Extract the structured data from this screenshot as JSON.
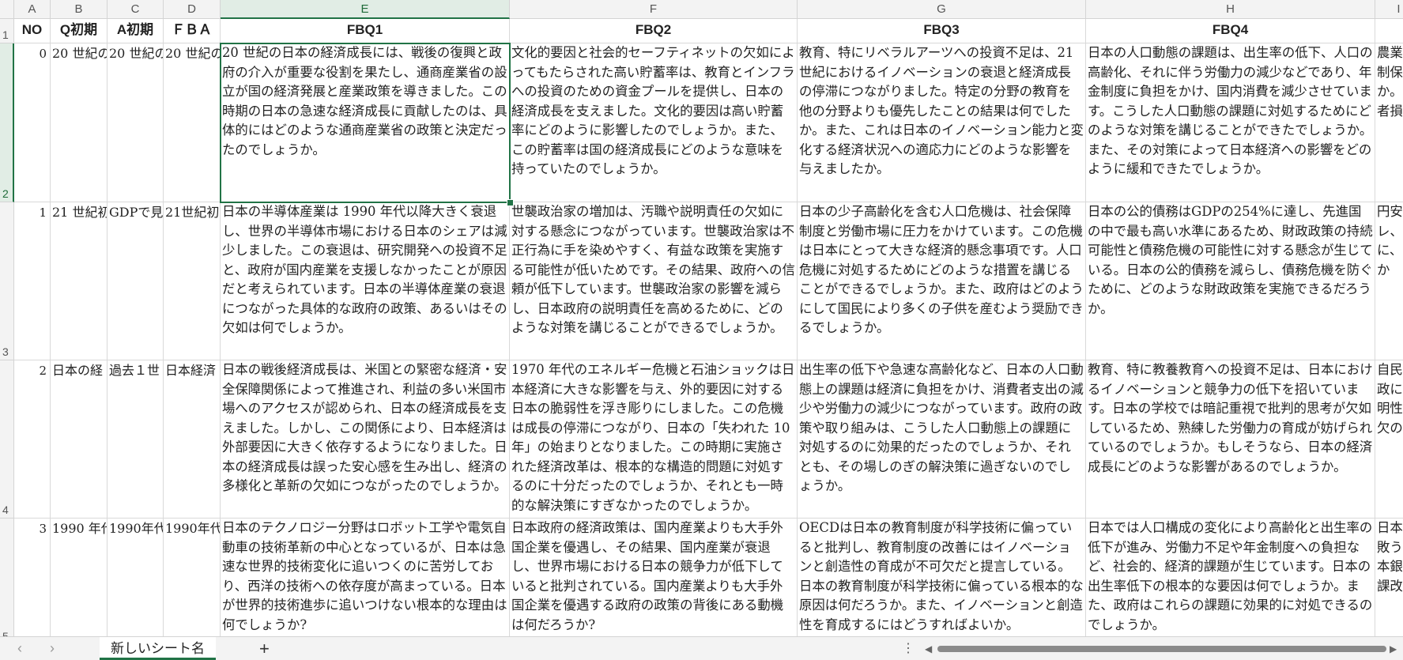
{
  "sheet": {
    "columns": [
      {
        "letter": "A",
        "header": "NO"
      },
      {
        "letter": "B",
        "header": "Q初期"
      },
      {
        "letter": "C",
        "header": "A初期"
      },
      {
        "letter": "D",
        "header": "ＦＢＡ"
      },
      {
        "letter": "E",
        "header": "FBQ1"
      },
      {
        "letter": "F",
        "header": "FBQ2"
      },
      {
        "letter": "G",
        "header": "FBQ3"
      },
      {
        "letter": "H",
        "header": "FBQ4"
      },
      {
        "letter": "I",
        "header": ""
      }
    ],
    "row_numbers": [
      "1",
      "2",
      "3",
      "4",
      "5"
    ],
    "rows": [
      {
        "no": "0",
        "b": "20 世紀の",
        "c": "20 世紀の",
        "d": "20 世紀の",
        "e": "20 世紀の日本の経済成長には、戦後の復興と政府の介入が重要な役割を果たし、通商産業省の設立が国の経済発展と産業政策を導きました。この時期の日本の急速な経済成長に貢献したのは、具体的にはどのような通商産業省の政策と決定だったのでしょうか。",
        "f": "文化的要因と社会的セーフティネットの欠如によってもたらされた高い貯蓄率は、教育とインフラへの投資のための資金プールを提供し、日本の経済成長を支えました。文化的要因は高い貯蓄率にどのように影響したのでしょうか。また、この貯蓄率は国の経済成長にどのような意味を持っていたのでしょうか。",
        "g": "教育、特にリベラルアーツへの投資不足は、21 世紀におけるイノベーションの衰退と経済成長の停滞につながりました。特定の分野の教育を他の分野よりも優先したことの結果は何でしたか。また、これは日本のイノベーション能力と変化する経済状況への適応力にどのような影響を与えましたか。",
        "h": "日本の人口動態の課題は、出生率の低下、人口の高齢化、それに伴う労働力の減少などであり、年金制度に負担をかけ、国内消費を減少させています。こうした人口動態の課題に対処するためにどのような対策を講じることができたでしょうか。また、その対策によって日本経済への影響をどのように緩和できたでしょうか。",
        "i": "農業抑制保護か。係者損害"
      },
      {
        "no": "1",
        "b": "21 世紀初",
        "c": "GDPで見",
        "d": "21世紀初",
        "e": "日本の半導体産業は 1990 年代以降大きく衰退し、世界の半導体市場における日本のシェアは減少しました。この衰退は、研究開発への投資不足と、政府が国内産業を支援しなかったことが原因だと考えられています。日本の半導体産業の衰退につながった具体的な政府の政策、あるいはその欠如は何でしょうか。",
        "f": "世襲政治家の増加は、汚職や説明責任の欠如に対する懸念につながっています。世襲政治家は不正行為に手を染めやすく、有益な政策を実施する可能性が低いためです。その結果、政府への信頼が低下しています。世襲政治家の影響を減らし、日本政府の説明責任を高めるために、どのような対策を講じることができるでしょうか。",
        "g": "日本の少子高齢化を含む人口危機は、社会保障制度と労働市場に圧力をかけています。この危機は日本にとって大きな経済的懸念事項です。人口危機に対処するためにどのような措置を講じることができるでしょうか。また、政府はどのようにして国民により多くの子供を産むよう奨励できるでしょうか。",
        "h": "日本の公的債務はGDPの254%に達し、先進国の中で最も高い水準にあるため、財政政策の持続可能性と債務危機の可能性に対する懸念が生じている。日本の公的債務を減らし、債務危機を防ぐために、どのような財政政策を実施できるだろうか。",
        "i": "円安レ、に、うか"
      },
      {
        "no": "2",
        "b": "日本の経",
        "c": "過去１世",
        "d": "日本経済",
        "e": "日本の戦後経済成長は、米国との緊密な経済・安全保障関係によって推進され、利益の多い米国市場へのアクセスが認められ、日本の経済成長を支えました。しかし、この関係により、日本経済は外部要因に大きく依存するようになりました。日本の経済成長は誤った安心感を生み出し、経済の多様化と革新の欠如につながったのでしょうか。",
        "f": "1970 年代のエネルギー危機と石油ショックは日本経済に大きな影響を与え、外的要因に対する日本の脆弱性を浮き彫りにしました。この危機は成長の停滞につながり、日本の「失われた 10 年」の始まりとなりました。この時期に実施された経済改革は、根本的な構造的問題に対処するのに十分だったのでしょうか、それとも一時的な解決策にすぎなかったのでしょうか。",
        "g": "出生率の低下や急速な高齢化など、日本の人口動態上の課題は経済に負担をかけ、消費者支出の減少や労働力の減少につながっています。政府の政策や取り組みは、こうした人口動態上の課題に対処するのに効果的だったのでしょうか、それとも、その場しのぎの解決策に過ぎないのでしょうか。",
        "h": "教育、特に教養教育への投資不足は、日本におけるイノベーションと競争力の低下を招いています。日本の学校では暗記重視で批判的思考が欠如しているため、熟練した労働力の育成が妨げられているのでしょうか。もしそうなら、日本の経済成長にどのような影響があるのでしょうか。",
        "i": "自民の政に対明性の欠のよ"
      },
      {
        "no": "3",
        "b": "1990 年代",
        "c": "1990年代",
        "d": "1990年代",
        "e": "日本のテクノロジー分野はロボット工学や電気自動車の技術革新の中心となっているが、日本は急速な世界的技術変化に追いつくのに苦労しており、西洋の技術への依存度が高まっている。日本が世界的技術進歩に追いつけない根本的な理由は何でしょうか?",
        "f": "日本政府の経済政策は、国内産業よりも大手外国企業を優遇し、その結果、国内産業が衰退し、世界市場における日本の競争力が低下していると批判されている。国内産業よりも大手外国企業を優遇する政府の政策の背後にある動機は何だろうか?",
        "g": "OECDは日本の教育制度が科学技術に偏っていると批判し、教育制度の改善にはイノベーションと創造性の育成が不可欠だと提言している。日本の教育制度が科学技術に偏っている根本的な原因は何だろうか。また、イノベーションと創造性を育成するにはどうすればよいか。",
        "h": "日本では人口構成の変化により高齢化と出生率の低下が進み、労働力不足や年金制度への負担など、社会的、経済的課題が生じています。日本の出生率低下の根本的な要因は何でしょうか。また、政府はこれらの課題に効果的に対処できるのでしょうか。",
        "i": "日本失敗うな本銀の課改善"
      }
    ]
  },
  "footer": {
    "prev_icon": "‹",
    "next_icon": "›",
    "active_tab": "新しいシート名",
    "add_icon": "+",
    "more_icon": "⋮",
    "scroll_left": "◀",
    "scroll_right": "▶"
  },
  "colors": {
    "accent": "#217346",
    "grid": "#d9d9d9",
    "header_bg": "#f3f3f3"
  }
}
